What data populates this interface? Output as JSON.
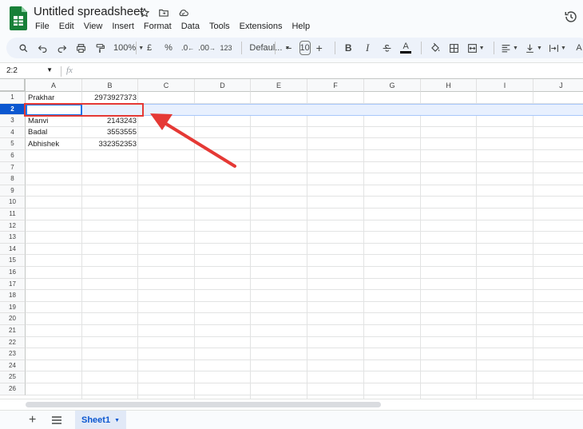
{
  "app": {
    "title": "Untitled spreadsheet",
    "menu": [
      "File",
      "Edit",
      "View",
      "Insert",
      "Format",
      "Data",
      "Tools",
      "Extensions",
      "Help"
    ]
  },
  "toolbar": {
    "zoom": "100%",
    "currency": "£",
    "percent": "%",
    "dec_decrease": ".0",
    "dec_increase": ".00",
    "number_format": "123",
    "font": "Defaul...",
    "font_size": "10",
    "minus": "−",
    "plus": "+",
    "bold": "B",
    "italic": "I",
    "text_color_letter": "A",
    "overflow_letter": "A"
  },
  "formula_bar": {
    "name_box": "2:2",
    "fx": "fx",
    "value": ""
  },
  "grid": {
    "columns": [
      "A",
      "B",
      "C",
      "D",
      "E",
      "F",
      "G",
      "H",
      "I",
      "J"
    ],
    "rows": [
      "1",
      "2",
      "3",
      "4",
      "5",
      "6",
      "7",
      "8",
      "9",
      "10",
      "11",
      "12",
      "13",
      "14",
      "15",
      "16",
      "17",
      "18",
      "19",
      "20",
      "21",
      "22",
      "23",
      "24",
      "25",
      "26"
    ],
    "selected_row": "2",
    "cells": [
      {
        "row": 1,
        "a": "Prakhar",
        "b": "2973927373"
      },
      {
        "row": 2,
        "a": "",
        "b": ""
      },
      {
        "row": 3,
        "a": "Manvi",
        "b": "2143243"
      },
      {
        "row": 4,
        "a": "Badal",
        "b": "3553555"
      },
      {
        "row": 5,
        "a": "Abhishek",
        "b": "332352353"
      }
    ]
  },
  "sheets": {
    "add_label": "+",
    "tabs": [
      "Sheet1"
    ]
  },
  "colors": {
    "accent": "#0b57d0",
    "highlight": "#e53935",
    "toolbar_bg": "#edf2fa",
    "sheets_green": "#188038"
  }
}
